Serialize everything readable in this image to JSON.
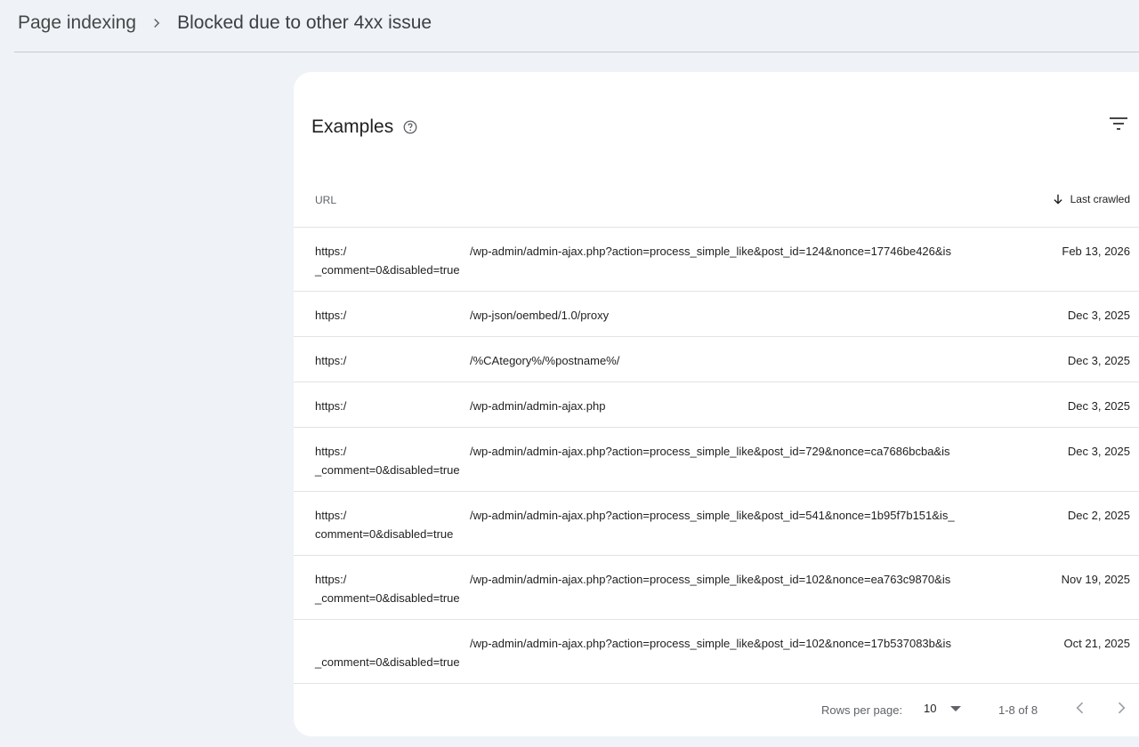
{
  "breadcrumb": {
    "parent": "Page indexing",
    "current": "Blocked due to other 4xx issue"
  },
  "card": {
    "title": "Examples"
  },
  "table": {
    "columns": {
      "url": "URL",
      "last_crawled": "Last crawled"
    },
    "rows": [
      {
        "prefix": "https:/",
        "line1": "/wp-admin/admin-ajax.php?action=process_simple_like&post_id=124&nonce=17746be426&is",
        "line2": "_comment=0&disabled=true",
        "date": "Feb 13, 2026"
      },
      {
        "prefix": "https:/",
        "line1": "/wp-json/oembed/1.0/proxy",
        "line2": "",
        "date": "Dec 3, 2025"
      },
      {
        "prefix": "https:/",
        "line1": "/%CAtegory%/%postname%/",
        "line2": "",
        "date": "Dec 3, 2025"
      },
      {
        "prefix": "https:/",
        "line1": "/wp-admin/admin-ajax.php",
        "line2": "",
        "date": "Dec 3, 2025"
      },
      {
        "prefix": "https:/",
        "line1": "/wp-admin/admin-ajax.php?action=process_simple_like&post_id=729&nonce=ca7686bcba&is",
        "line2": "_comment=0&disabled=true",
        "date": "Dec 3, 2025"
      },
      {
        "prefix": "https:/",
        "line1": "/wp-admin/admin-ajax.php?action=process_simple_like&post_id=541&nonce=1b95f7b151&is_",
        "line2": "comment=0&disabled=true",
        "date": "Dec 2, 2025"
      },
      {
        "prefix": "https:/",
        "line1": "/wp-admin/admin-ajax.php?action=process_simple_like&post_id=102&nonce=ea763c9870&is",
        "line2": "_comment=0&disabled=true",
        "date": "Nov 19, 2025"
      },
      {
        "prefix": "",
        "line1": "/wp-admin/admin-ajax.php?action=process_simple_like&post_id=102&nonce=17b537083b&is",
        "line2": "_comment=0&disabled=true",
        "date": "Oct 21, 2025"
      }
    ]
  },
  "pagination": {
    "rows_per_page_label": "Rows per page:",
    "rows_per_page_value": "10",
    "range": "1-8 of 8"
  },
  "icons": {
    "breadcrumb_separator": "chevron-right-icon",
    "help": "help-circle-icon",
    "filter": "filter-icon",
    "sort": "arrow-down-icon",
    "dropdown": "caret-down-icon",
    "prev": "chevron-left-icon",
    "next": "chevron-right-icon"
  }
}
